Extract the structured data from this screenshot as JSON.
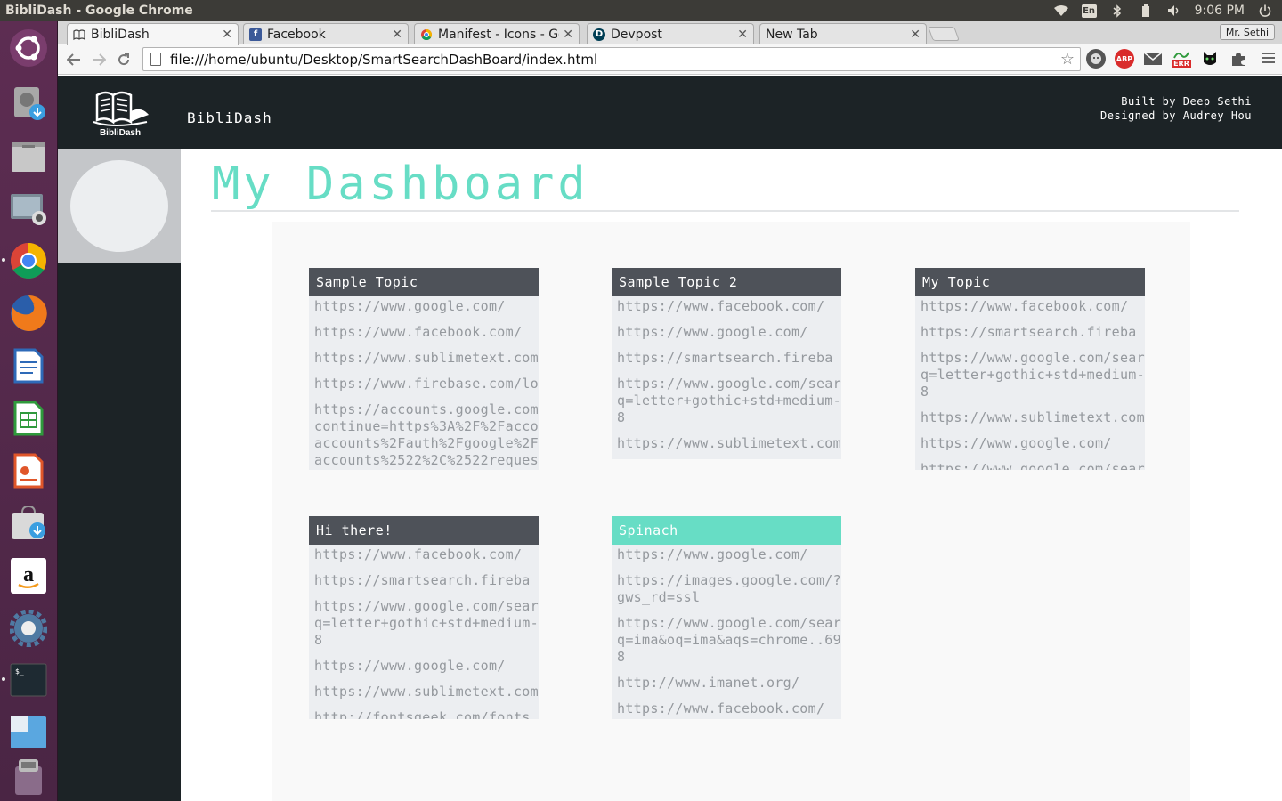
{
  "os": {
    "window_title": "BibliDash - Google Chrome",
    "clock": "9:06 PM",
    "keyboard_layout": "En"
  },
  "browser": {
    "tabs": [
      {
        "label": "BibliDash",
        "favicon": "book-icon",
        "active": true
      },
      {
        "label": "Facebook",
        "favicon": "facebook-icon",
        "active": false
      },
      {
        "label": "Manifest - Icons - Goo",
        "favicon": "google-icon",
        "active": false
      },
      {
        "label": "Devpost",
        "favicon": "devpost-icon",
        "active": false
      },
      {
        "label": "New Tab",
        "favicon": "",
        "active": false
      }
    ],
    "profile_name": "Mr. Sethi",
    "url": "file:///home/ubuntu/Desktop/SmartSearchDashBoard/index.html",
    "extensions": [
      {
        "name": "ghost-extension-icon",
        "color": "#555555",
        "label": ""
      },
      {
        "name": "adblock-icon",
        "color": "#d92b2b",
        "label": "ABP"
      },
      {
        "name": "mail-icon",
        "color": "#555555",
        "label": ""
      },
      {
        "name": "error-extension-icon",
        "color": "#d92b2b",
        "label": "ERR"
      },
      {
        "name": "cat-extension-icon",
        "color": "#111111",
        "label": ""
      },
      {
        "name": "puzzle-extension-icon",
        "color": "#555555",
        "label": ""
      }
    ]
  },
  "site": {
    "brand_logo_text": "BibliDash",
    "brand_name": "BibliDash",
    "credits_line1": "Built by Deep Sethi",
    "credits_line2": "Designed by Audrey Hou",
    "page_title": "My Dashboard",
    "colors": {
      "accent": "#67ddc5",
      "header_bg": "#1c2326",
      "card_head": "#4e5259",
      "card_body": "#eceef1",
      "link_text": "#95999e"
    }
  },
  "cards": [
    {
      "title": "Sample Topic",
      "highlighted": false,
      "links": [
        "https://www.google.com/",
        "https://www.facebook.com/",
        "https://www.sublimetext.com",
        "https://www.firebase.com/lo",
        "https://accounts.google.com\ncontinue=https%3A%2F%2Facco\naccounts%2Fauth%2Fgoogle%2F\naccounts%2522%2C%2522reques"
      ]
    },
    {
      "title": "Sample Topic 2",
      "highlighted": false,
      "links": [
        "https://www.facebook.com/",
        "https://www.google.com/",
        "https://smartsearch.fireba",
        "https://www.google.com/sear\nq=letter+gothic+std+medium-\n8",
        "https://www.sublimetext.com"
      ]
    },
    {
      "title": "My Topic",
      "highlighted": false,
      "links": [
        "https://www.facebook.com/",
        "https://smartsearch.fireba",
        "https://www.google.com/sear\nq=letter+gothic+std+medium-\n8",
        "https://www.sublimetext.com",
        "https://www.google.com/",
        "https://www.google.com/sear"
      ]
    },
    {
      "title": "Hi there!",
      "highlighted": false,
      "links": [
        "https://www.facebook.com/",
        "https://smartsearch.fireba",
        "https://www.google.com/sear\nq=letter+gothic+std+medium-\n8",
        "https://www.google.com/",
        "https://www.sublimetext.com",
        "http://fontsgeek.com/fonts"
      ]
    },
    {
      "title": "Spinach",
      "highlighted": true,
      "links": [
        "https://www.google.com/",
        "https://images.google.com/?\ngws_rd=ssl",
        "https://www.google.com/sear\nq=ima&oq=ima&aqs=chrome..69\n8",
        "http://www.imanet.org/",
        "https://www.facebook.com/"
      ]
    }
  ],
  "launcher": [
    {
      "name": "ubuntu-dash-icon"
    },
    {
      "name": "disk-installer-icon"
    },
    {
      "name": "files-icon"
    },
    {
      "name": "screenshot-icon"
    },
    {
      "name": "chrome-icon"
    },
    {
      "name": "firefox-icon"
    },
    {
      "name": "writer-icon"
    },
    {
      "name": "calc-icon"
    },
    {
      "name": "impress-icon"
    },
    {
      "name": "software-center-icon"
    },
    {
      "name": "amazon-icon"
    },
    {
      "name": "settings-icon"
    },
    {
      "name": "terminal-icon"
    },
    {
      "name": "workspaces-icon"
    },
    {
      "name": "trash-icon"
    }
  ]
}
